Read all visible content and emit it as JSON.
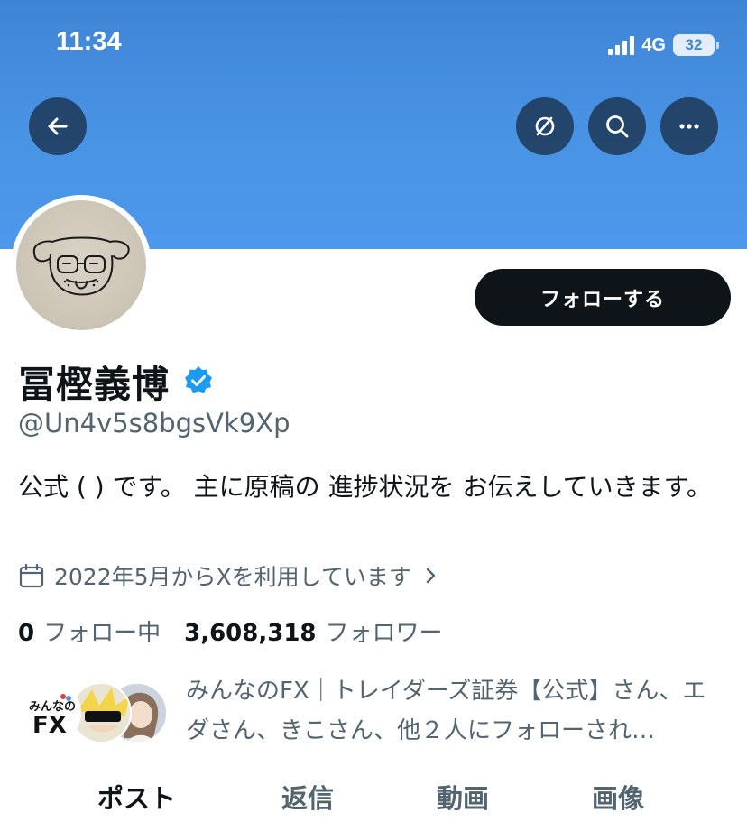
{
  "status_bar": {
    "time": "11:34",
    "network": "4G",
    "battery_level": "32"
  },
  "header": {
    "back_icon": "arrow-left-icon",
    "actions": [
      {
        "name": "grok-icon"
      },
      {
        "name": "search-icon"
      },
      {
        "name": "more-icon"
      }
    ],
    "banner_color": "#4a94e6"
  },
  "profile": {
    "avatar_icon": "dog-face-drawing",
    "follow_button_label": "フォローする",
    "display_name": "冨樫義博",
    "verified_icon": "verified-badge-icon",
    "verified_color": "#1d9bf0",
    "handle": "@Un4v5s8bgsVk9Xp",
    "bio": "公式 ( ) です。 主に原稿の 進捗状況を お伝えしていきます。",
    "joined": "2022年5月からXを利用しています",
    "following_count": "0",
    "following_label": "フォロー中",
    "followers_count": "3,608,318",
    "followers_label": "フォロワー",
    "followed_by": "みんなのFX｜トレイダーズ証券【公式】さん、エダさん、きこさん、他２人にフォローされ…",
    "followed_by_avatar_text": "みんなのFX"
  },
  "tabs": [
    {
      "label": "ポスト",
      "active": true
    },
    {
      "label": "返信",
      "active": false
    },
    {
      "label": "動画",
      "active": false
    },
    {
      "label": "画像",
      "active": false
    }
  ]
}
